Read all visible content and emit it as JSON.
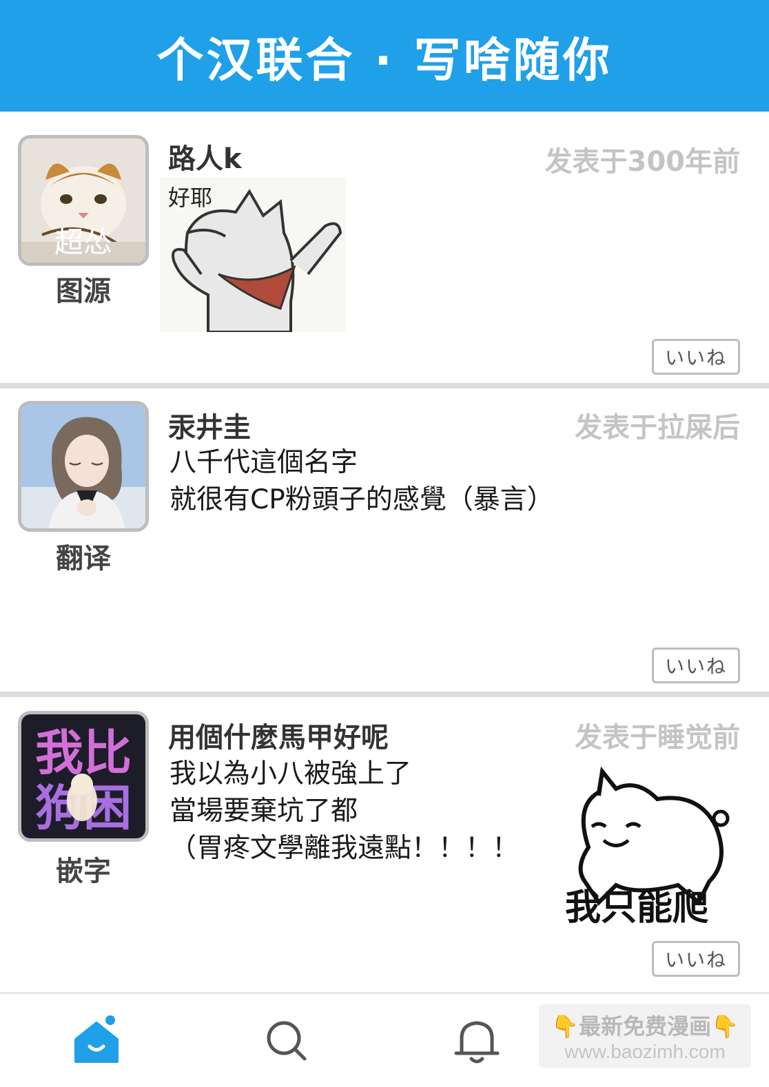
{
  "header": {
    "title": "个汉联合 · 写啥随你"
  },
  "posts": [
    {
      "username": "路人k",
      "timestamp": "发表于300年前",
      "role": "图源",
      "avatar_text": "超怂",
      "body_lines": [
        "好耶"
      ],
      "like_label": "いいね"
    },
    {
      "username": "汞井圭",
      "timestamp": "发表于拉屎后",
      "role": "翻译",
      "body_lines": [
        "八千代這個名字",
        "就很有CP粉頭子的感覺（暴言）"
      ],
      "like_label": "いいね"
    },
    {
      "username": "用個什麼馬甲好呢",
      "timestamp": "发表于睡觉前",
      "role": "嵌字",
      "avatar_text_top": "我比",
      "avatar_text_bottom": "狗困",
      "body_lines": [
        "我以為小八被強上了",
        "當場要棄坑了都",
        "（胃疼文學離我遠點！！！！"
      ],
      "sticker_caption": "我只能爬",
      "like_label": "いいね"
    }
  ],
  "tabbar": {
    "items": [
      {
        "icon": "home-icon",
        "active": true
      },
      {
        "icon": "search-icon",
        "active": false
      },
      {
        "icon": "bell-icon",
        "active": false
      }
    ]
  },
  "watermark": {
    "line1": "👇最新免费漫画👇",
    "line2": "www.baozimh.com"
  },
  "colors": {
    "header_bg": "#1fa0e8",
    "accent": "#1fa0e8",
    "timestamp": "#c4c4c4"
  }
}
